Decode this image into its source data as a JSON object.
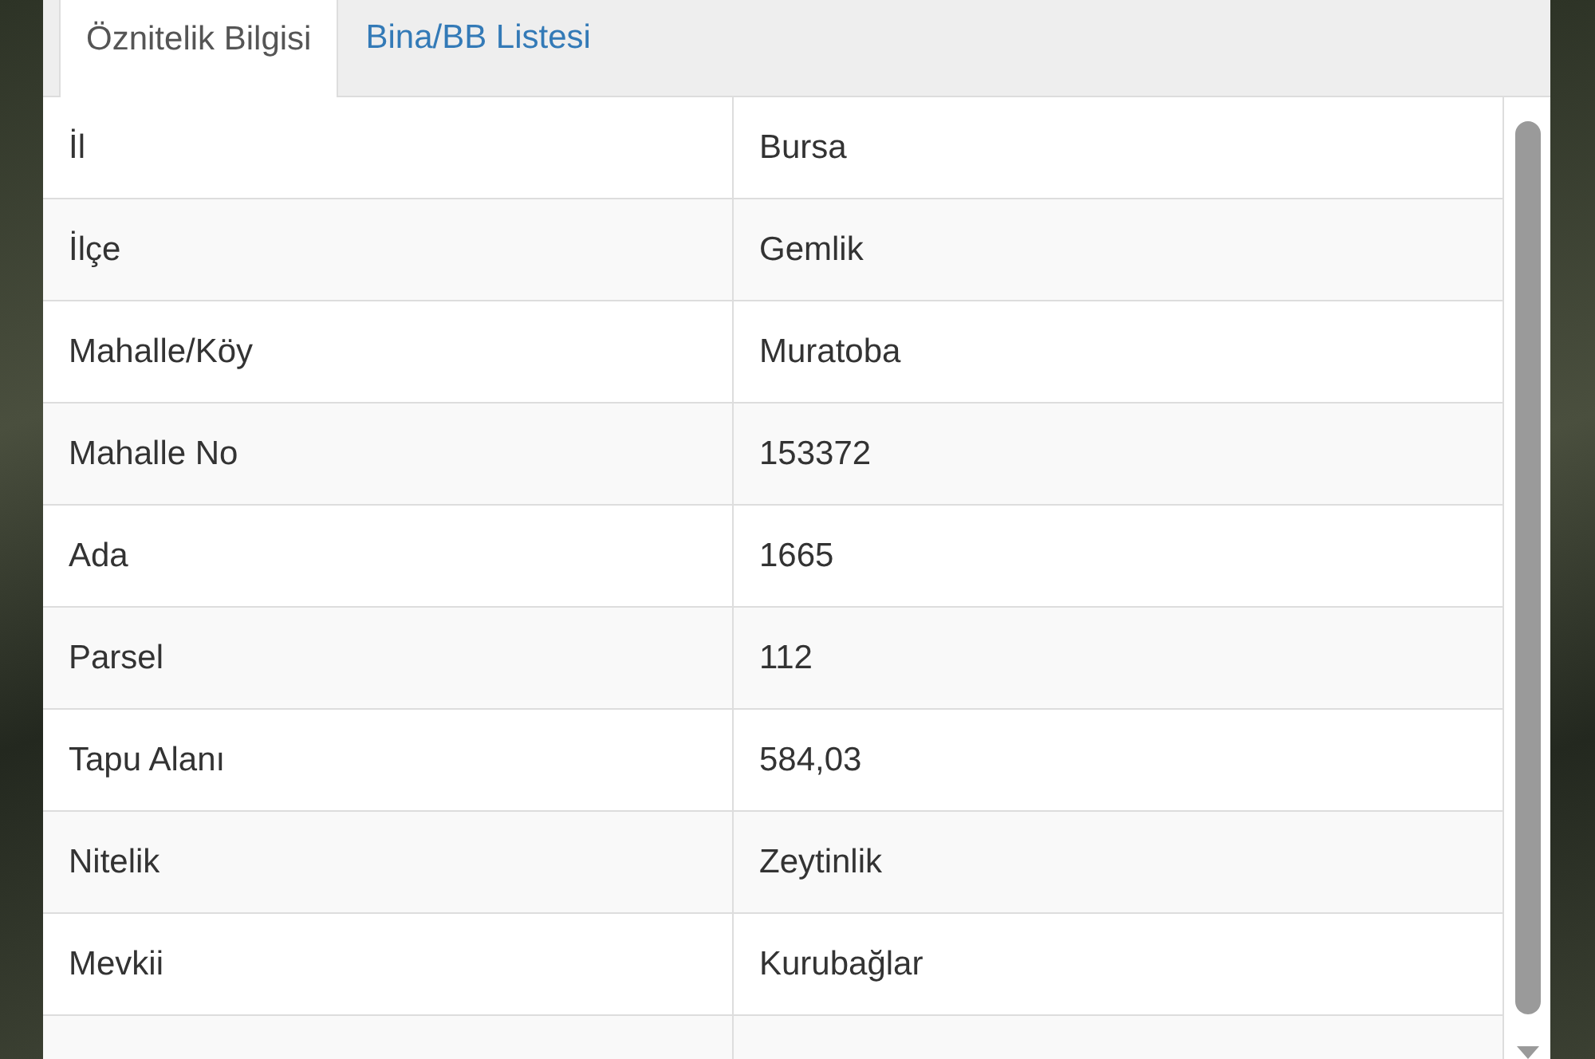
{
  "tabs": [
    {
      "label": "Öznitelik Bilgisi",
      "selected": true
    },
    {
      "label": "Bina/BB Listesi",
      "selected": false
    }
  ],
  "table": {
    "rows": [
      {
        "label": "İl",
        "value": "Bursa"
      },
      {
        "label": "İlçe",
        "value": "Gemlik"
      },
      {
        "label": "Mahalle/Köy",
        "value": "Muratoba"
      },
      {
        "label": "Mahalle No",
        "value": "153372"
      },
      {
        "label": "Ada",
        "value": "1665"
      },
      {
        "label": "Parsel",
        "value": "112"
      },
      {
        "label": "Tapu Alanı",
        "value": "584,03"
      },
      {
        "label": "Nitelik",
        "value": "Zeytinlik"
      },
      {
        "label": "Mevkii",
        "value": "Kurubağlar"
      }
    ]
  }
}
